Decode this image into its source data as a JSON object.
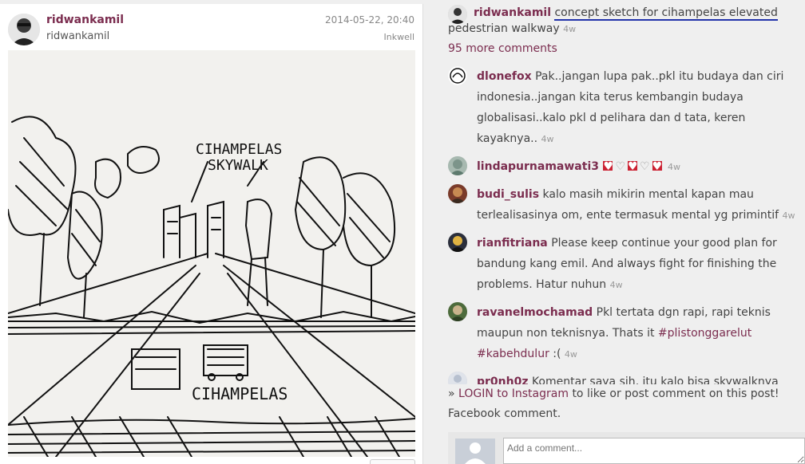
{
  "post": {
    "author": "ridwankamil",
    "author_sub": "ridwankamil",
    "date": "2014-05-22, 20:40",
    "filter": "Inkwell",
    "photo_labels": {
      "title_line1": "CIHAMPELAS",
      "title_line2": "SKYWALK",
      "bottom": "CIHAMPELAS"
    }
  },
  "caption": {
    "user": "ridwankamil",
    "text_line1": "concept sketch for cihampelas elevated",
    "text_line2": "pedestrian walkway",
    "ago": "4w"
  },
  "more_comments": "95 more comments",
  "comments": [
    {
      "user": "dlonefox",
      "text": "Pak..jangan lupa pak..pkl itu budaya dan ciri indonesia..jangan kita terus kembangin budaya globalisasi..kalo pkl d pelihara dan d tata, keren kayaknya..",
      "ago": "4w"
    },
    {
      "user": "lindapurnamawati3",
      "ago": "4w"
    },
    {
      "user": "budi_sulis",
      "text": "kalo masih mikirin mental kapan mau terlealisasinya om, ente termasuk mental yg primintif",
      "ago": "4w"
    },
    {
      "user": "rianfitriana",
      "text": "Please keep continue your good plan for bandung kang emil. And always fight for finishing the problems. Hatur nuhun",
      "ago": "4w"
    },
    {
      "user": "ravanelmochamad",
      "text": "Pkl tertata dgn rapi, rapi teknis maupun non teknisnya. Thats it",
      "tag1": "#plistonggarelut",
      "tag2": "#kabehdulur",
      "tail": ":(",
      "ago": "4w"
    },
    {
      "user": "pr0nh0z",
      "text": "Komentar saya sih, itu kalo bisa skywalknya agak"
    }
  ],
  "login": {
    "prefix": "»",
    "link": "LOGIN to Instagram",
    "suffix": "to like or post comment on this post!"
  },
  "facebook": {
    "label": "Facebook comment.",
    "placeholder": "Add a comment..."
  },
  "colors": {
    "username": "#7b2d4f",
    "underline": "#2233aa"
  }
}
